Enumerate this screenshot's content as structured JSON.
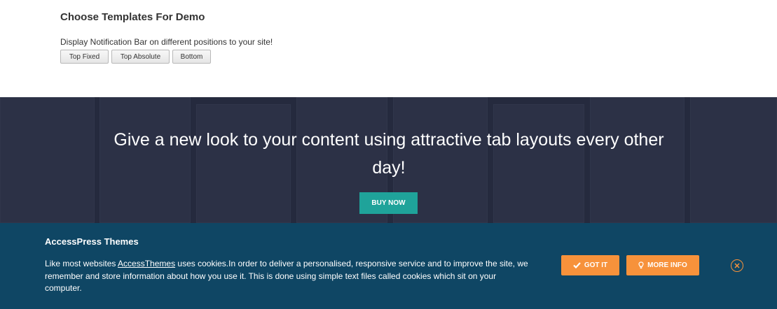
{
  "demo": {
    "title": "Choose Templates For Demo",
    "description": "Display Notification Bar on different positions to your site!",
    "buttons": [
      "Top Fixed",
      "Top Absolute",
      "Bottom"
    ]
  },
  "hero": {
    "headline": "Give a new look to your content using attractive tab layouts every other day!",
    "buy_label": "BUY NOW"
  },
  "cookie_bar": {
    "title": "AccessPress Themes",
    "text_before": "Like most websites ",
    "link_text": "AccessThemes",
    "text_after": " uses cookies.In order to deliver a personalised, responsive service and to improve the site, we remember and store information about how you use it. This is done using simple text files called cookies which sit on your computer.",
    "got_it_label": "GOT IT",
    "more_info_label": "MORE INFO",
    "icons": [
      "check-icon",
      "lightbulb-icon",
      "close-icon"
    ]
  },
  "colors": {
    "accent_orange": "#f7923b",
    "cookie_bg": "#0f4664",
    "buy_teal": "#1fa39a",
    "hero_bg": "#252a3e"
  }
}
